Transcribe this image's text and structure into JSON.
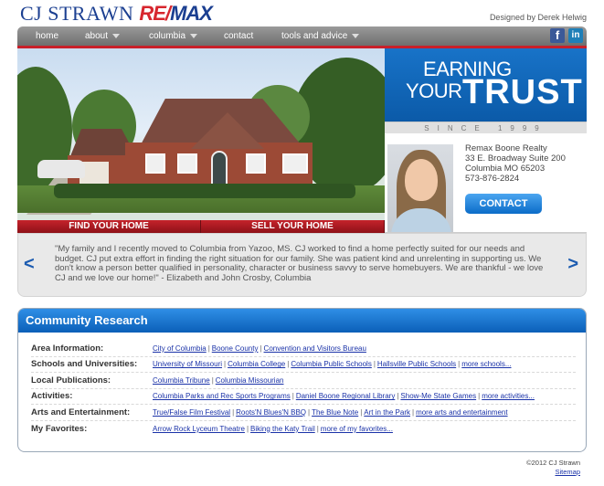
{
  "header": {
    "logo_name": "CJ STRAWN",
    "logo_brand_re": "RE/",
    "logo_brand_max": "MAX",
    "designed_by": "Designed by Derek Helwig"
  },
  "nav": {
    "items": [
      "home",
      "about",
      "columbia",
      "contact",
      "tools and advice"
    ],
    "social": [
      "facebook-icon",
      "linkedin-icon"
    ],
    "accent_color": "#c8202a"
  },
  "hero": {
    "find_home": "FIND YOUR HOME",
    "sell_home": "SELL YOUR HOME"
  },
  "trust": {
    "line1": "EARNING",
    "line2": "YOUR",
    "big": "TRUST",
    "since": "SINCE 1999"
  },
  "agent": {
    "company": "Remax Boone Realty",
    "address": "33 E. Broadway Suite 200",
    "city": "Columbia MO 65203",
    "phone": "573-876-2824",
    "contact_label": "CONTACT"
  },
  "testimonial": {
    "text": "\"My family and I recently moved to Columbia from Yazoo, MS. CJ worked to find a home perfectly suited for our needs and budget. CJ put extra effort in finding the right situation for our family. She was patient kind and unrelenting in supporting us. We don't know a person better qualified in personality, character or business savvy to serve homebuyers. We are thankful - we love CJ and we love our home!\" - Elizabeth and John Crosby, Columbia",
    "prev": "<",
    "next": ">"
  },
  "community": {
    "title": "Community Research",
    "rows": [
      {
        "label": "Area Information:",
        "links": [
          "City of Columbia",
          "Boone County",
          "Convention and Visitors Bureau"
        ]
      },
      {
        "label": "Schools and Universities:",
        "links": [
          "University of Missouri",
          "Columbia College",
          "Columbia Public Schools",
          "Hallsville Public Schools",
          "more schools..."
        ]
      },
      {
        "label": "Local Publications:",
        "links": [
          "Columbia Tribune",
          "Columbia Missourian"
        ]
      },
      {
        "label": "Activities:",
        "links": [
          "Columbia Parks and Rec Sports Programs",
          "Daniel Boone Regional Library",
          "Show-Me State Games",
          "more activities..."
        ]
      },
      {
        "label": "Arts and Entertainment:",
        "links": [
          "True/False Film Festival",
          "Roots'N Blues'N BBQ",
          "The Blue Note",
          "Art in the Park",
          "more arts and entertainment"
        ]
      },
      {
        "label": "My Favorites:",
        "links": [
          "Arrow Rock Lyceum Theatre",
          "Biking the Katy Trail",
          "more of my favorites..."
        ]
      }
    ]
  },
  "footer": {
    "copyright": "©2012 CJ Strawn",
    "sitemap": "Sitemap"
  }
}
